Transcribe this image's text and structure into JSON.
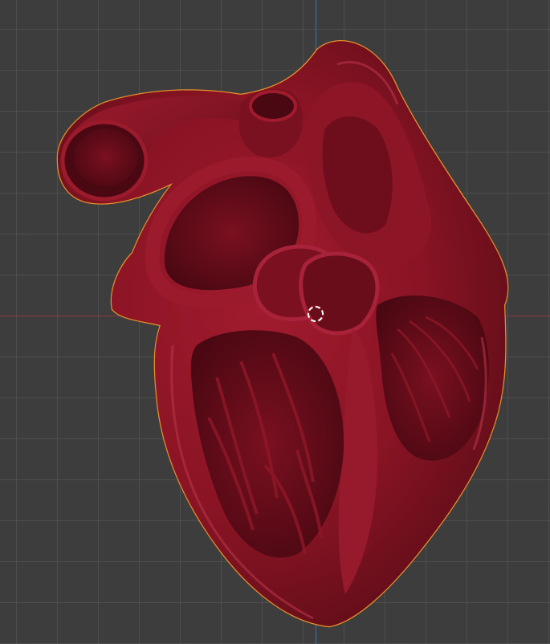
{
  "viewport": {
    "background_color": "#3d3d3d",
    "grid_color": "#5a5a5a",
    "x_axis_color": "#8a3a3a",
    "y_axis_color": "#3f6eaa"
  },
  "object": {
    "name": "heart-model",
    "base_color": "#8a1424",
    "shadow_color": "#4a0a12",
    "highlight_color": "#b83447",
    "selection_outline_color": "#e8902a",
    "selected": true
  },
  "cursor_3d": {
    "icon": "3d-cursor-icon"
  }
}
